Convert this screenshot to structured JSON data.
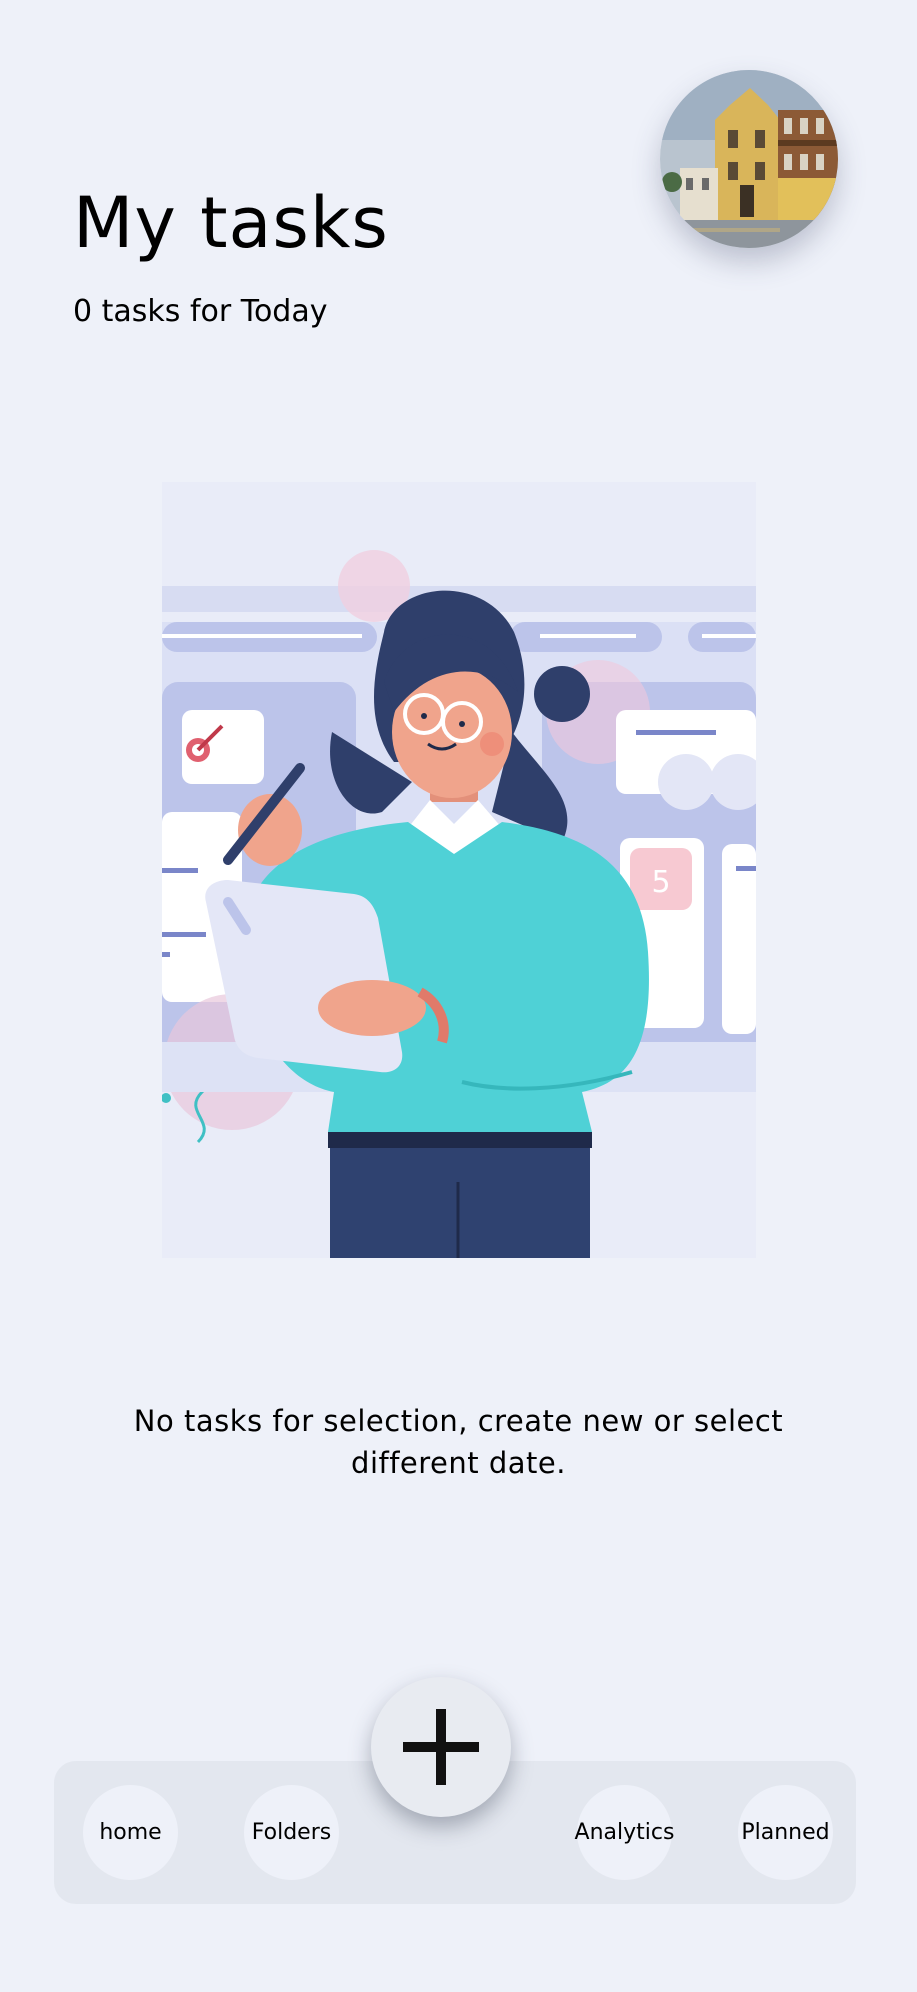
{
  "header": {
    "title": "My tasks",
    "subtitle": "0 tasks for Today"
  },
  "profile": {
    "avatar_icon": "profile-photo-building"
  },
  "illustration": {
    "icon": "woman-with-clipboard-illustration",
    "calendar_badge": "5"
  },
  "empty_state": {
    "message": "No tasks for selection, create new or select different date."
  },
  "add_button": {
    "icon": "plus-icon"
  },
  "nav": {
    "items": [
      {
        "label": "home"
      },
      {
        "label": "Folders"
      },
      {
        "label": "Analytics"
      },
      {
        "label": "Planned"
      }
    ]
  },
  "colors": {
    "background": "#eef1f9",
    "nav_bar": "#e3e7ef",
    "accent_sweater": "#4fd1d6",
    "accent_navy": "#2f3f6b"
  }
}
